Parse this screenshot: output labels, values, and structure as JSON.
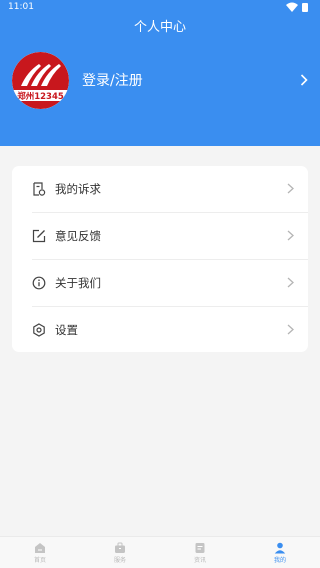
{
  "status_bar": {
    "time": "11:01"
  },
  "header": {
    "title": "个人中心",
    "login_label": "登录/注册",
    "avatar_text": "郑州12345"
  },
  "menu": {
    "items": [
      {
        "label": "我的诉求",
        "icon": "complaint-doc-icon"
      },
      {
        "label": "意见反馈",
        "icon": "edit-icon"
      },
      {
        "label": "关于我们",
        "icon": "info-icon"
      },
      {
        "label": "设置",
        "icon": "settings-hexagon-icon"
      }
    ]
  },
  "tab_bar": {
    "tabs": [
      {
        "label": "首页",
        "icon": "home-icon",
        "active": false
      },
      {
        "label": "服务",
        "icon": "briefcase-icon",
        "active": false
      },
      {
        "label": "资讯",
        "icon": "news-icon",
        "active": false
      },
      {
        "label": "我的",
        "icon": "user-icon",
        "active": true
      }
    ]
  },
  "colors": {
    "accent": "#3a8ef0",
    "background": "#f4f4f4",
    "logo_red": "#c8171d"
  }
}
